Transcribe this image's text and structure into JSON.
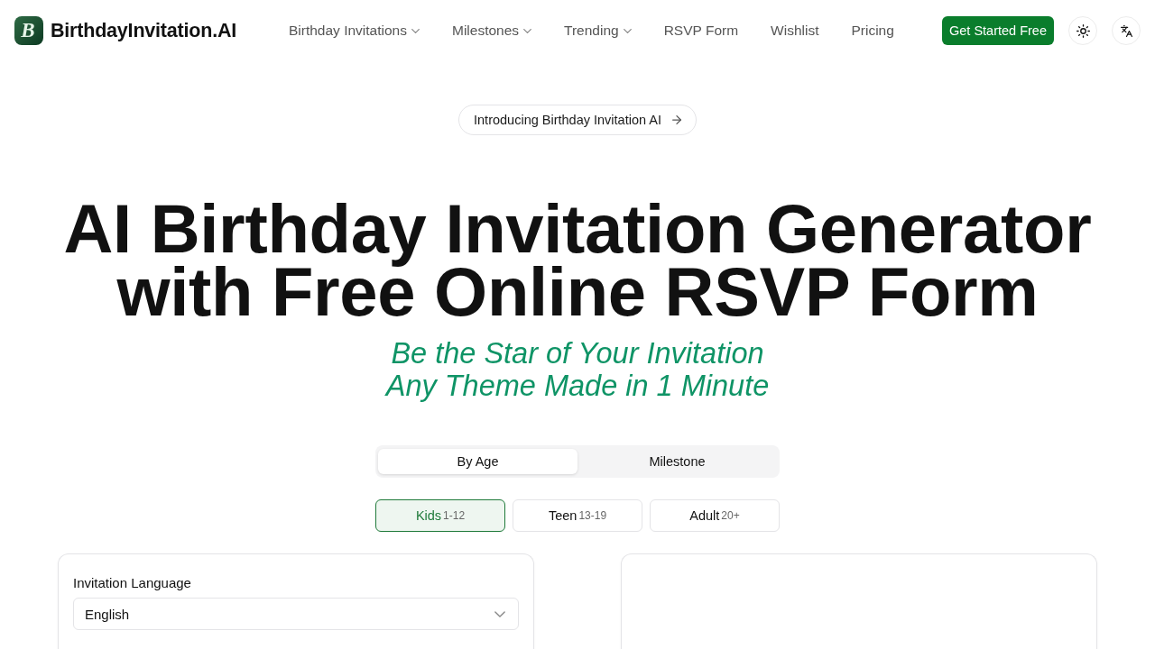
{
  "header": {
    "logo_letter": "B",
    "brand": "BirthdayInvitation.AI",
    "nav": [
      {
        "label": "Birthday Invitations",
        "has_menu": true
      },
      {
        "label": "Milestones",
        "has_menu": true
      },
      {
        "label": "Trending",
        "has_menu": true
      },
      {
        "label": "RSVP Form",
        "has_menu": false
      },
      {
        "label": "Wishlist",
        "has_menu": false
      },
      {
        "label": "Pricing",
        "has_menu": false
      }
    ],
    "cta": "Get Started Free"
  },
  "announcement": {
    "label": "Introducing Birthday Invitation AI"
  },
  "hero": {
    "title_lines": [
      "AI Birthday Invitation Generator",
      "with Free Online RSVP Form"
    ],
    "tagline_lines": [
      "Be the Star of Your Invitation",
      "Any Theme Made in 1 Minute"
    ]
  },
  "mode_tabs": [
    {
      "label": "By Age",
      "selected": true
    },
    {
      "label": "Milestone",
      "selected": false
    }
  ],
  "age_groups": [
    {
      "label": "Kids",
      "range": "1-12",
      "selected": true
    },
    {
      "label": "Teen",
      "range": "13-19",
      "selected": false
    },
    {
      "label": "Adult",
      "range": "20+",
      "selected": false
    }
  ],
  "language_field": {
    "label": "Invitation Language",
    "value": "English"
  }
}
